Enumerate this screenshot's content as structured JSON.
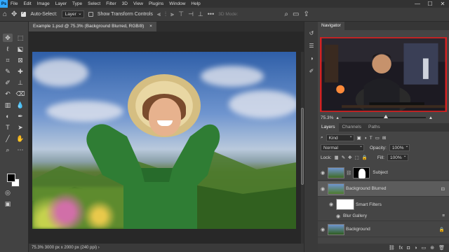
{
  "menu": {
    "logo": "Ps",
    "items": [
      "File",
      "Edit",
      "Image",
      "Layer",
      "Type",
      "Select",
      "Filter",
      "3D",
      "View",
      "Plugins",
      "Window",
      "Help"
    ],
    "controls": [
      "—",
      "☐",
      "✕"
    ]
  },
  "options": {
    "auto_select_label": "Auto-Select:",
    "auto_select_checked": true,
    "target": "Layer",
    "transform_label": "Show Transform Controls",
    "transform_checked": false,
    "mode3d": "3D Mode:",
    "more": "•••"
  },
  "document": {
    "tab_label": "Example 1.psd @ 75.3% (Background Blurred, RGB/8)",
    "close": "×",
    "status": "75.3%   3000 px x 2000 px (240 ppi)   ›"
  },
  "colors": {
    "accent": "#31a8ff",
    "panel_bg": "#454545",
    "selected_layer": "#5c5c5c"
  },
  "navigator": {
    "title": "Navigator",
    "zoom": "75.3%"
  },
  "layers_panel": {
    "tabs": [
      "Layers",
      "Channels",
      "Paths"
    ],
    "kind_label": "Kind",
    "blend_mode": "Normal",
    "opacity_label": "Opacity:",
    "opacity_value": "100%",
    "lock_label": "Lock:",
    "fill_label": "Fill:",
    "fill_value": "100%",
    "layers": [
      {
        "name": "Subject",
        "visible": true,
        "selected": false
      },
      {
        "name": "Background Blurred",
        "visible": true,
        "selected": true
      },
      {
        "name": "Smart Filters",
        "visible": true,
        "selected": false
      },
      {
        "name": "Blur Gallery",
        "visible": true,
        "selected": false
      },
      {
        "name": "Background",
        "visible": true,
        "selected": false
      }
    ],
    "fx_label": "fx"
  }
}
